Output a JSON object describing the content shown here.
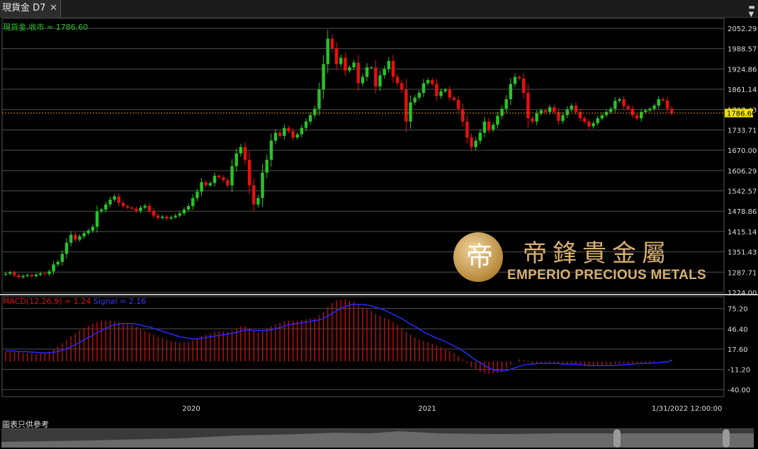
{
  "window": {
    "tab_title": "現貨金 D7",
    "close_glyph": "✕",
    "menu_glyph": "▬\n▼"
  },
  "legend": {
    "price": "現貨金.收市 = 1786.60",
    "macd": "MACD(12,26,9) = 1.24",
    "signal": "Signal = 2.16"
  },
  "footer": {
    "label": "圖表只供參考"
  },
  "logo": {
    "glyph": "帝",
    "chinese": "帝鋒貴金屬",
    "english": "EMPERIO PRECIOUS METALS"
  },
  "colors": {
    "up": "#27c427",
    "down": "#e81010",
    "macd_hist": "#e01010",
    "signal": "#2a2aff",
    "grid": "#505050",
    "last_price_line": "#d08a10"
  },
  "chart_data": [
    {
      "type": "candlestick",
      "title": "現貨金.收市",
      "x_labels": [
        "2020",
        "2021",
        "1/31/2022 12:00:00"
      ],
      "y_ticks": [
        1224.0,
        1287.71,
        1351.43,
        1415.14,
        1478.86,
        1542.57,
        1606.29,
        1670.0,
        1733.71,
        1797.43,
        1861.14,
        1924.86,
        1988.57,
        2052.29
      ],
      "ylim": [
        1224.0,
        2070.0
      ],
      "last_price": 1786.6,
      "last_price_label": "1786.60",
      "closes": [
        1283,
        1287,
        1278,
        1272,
        1276,
        1279,
        1275,
        1280,
        1284,
        1282,
        1290,
        1312,
        1320,
        1345,
        1380,
        1405,
        1390,
        1400,
        1410,
        1418,
        1430,
        1478,
        1484,
        1500,
        1515,
        1525,
        1505,
        1495,
        1490,
        1487,
        1480,
        1490,
        1496,
        1480,
        1465,
        1458,
        1462,
        1456,
        1460,
        1465,
        1472,
        1484,
        1495,
        1520,
        1540,
        1570,
        1560,
        1567,
        1590,
        1585,
        1576,
        1560,
        1620,
        1660,
        1680,
        1640,
        1560,
        1500,
        1520,
        1600,
        1640,
        1700,
        1725,
        1715,
        1740,
        1730,
        1710,
        1720,
        1740,
        1760,
        1780,
        1800,
        1860,
        1940,
        2020,
        1990,
        1940,
        1960,
        1920,
        1930,
        1945,
        1880,
        1900,
        1930,
        1930,
        1870,
        1905,
        1925,
        1950,
        1900,
        1880,
        1860,
        1760,
        1820,
        1835,
        1850,
        1880,
        1890,
        1878,
        1840,
        1855,
        1860,
        1835,
        1828,
        1800,
        1760,
        1710,
        1680,
        1700,
        1725,
        1760,
        1735,
        1750,
        1778,
        1800,
        1830,
        1878,
        1900,
        1895,
        1850,
        1770,
        1760,
        1785,
        1795,
        1790,
        1805,
        1790,
        1762,
        1780,
        1798,
        1810,
        1790,
        1770,
        1760,
        1745,
        1755,
        1770,
        1780,
        1790,
        1800,
        1825,
        1830,
        1808,
        1800,
        1780,
        1770,
        1790,
        1795,
        1800,
        1810,
        1830,
        1826,
        1800,
        1786.6
      ],
      "series": [
        {
          "name": "MACD(12,26,9)",
          "type": "bar",
          "values": [
            14,
            14,
            13,
            13,
            12,
            12,
            11,
            11,
            11,
            12,
            14,
            17,
            21,
            26,
            31,
            36,
            40,
            44,
            48,
            51,
            54,
            56,
            58,
            58,
            58,
            57,
            56,
            55,
            54,
            52,
            49,
            46,
            43,
            41,
            38,
            35,
            33,
            31,
            29,
            28,
            27,
            27,
            28,
            30,
            33,
            36,
            38,
            40,
            42,
            43,
            43,
            42,
            44,
            47,
            50,
            50,
            47,
            43,
            41,
            43,
            46,
            50,
            53,
            55,
            57,
            58,
            58,
            58,
            59,
            60,
            61,
            62,
            65,
            70,
            78,
            83,
            87,
            88,
            88,
            86,
            84,
            80,
            77,
            75,
            72,
            68,
            65,
            62,
            60,
            56,
            52,
            48,
            42,
            38,
            34,
            31,
            29,
            27,
            25,
            22,
            20,
            18,
            15,
            12,
            8,
            3,
            -3,
            -8,
            -12,
            -15,
            -17,
            -18,
            -17,
            -16,
            -14,
            -10,
            -5,
            0,
            3,
            2,
            -1,
            -3,
            -3,
            -3,
            -4,
            -3,
            -3,
            -4,
            -4,
            -4,
            -4,
            -5,
            -6,
            -7,
            -7,
            -7,
            -7,
            -7,
            -6,
            -5,
            -4,
            -3,
            -3,
            -3,
            -3,
            -3,
            -3,
            -3,
            -2,
            -1,
            0,
            0,
            0,
            1.24
          ]
        },
        {
          "name": "Signal",
          "type": "line",
          "values": [
            15,
            15,
            15,
            14,
            14,
            14,
            13,
            13,
            12,
            12,
            12,
            13,
            14,
            16,
            18,
            21,
            24,
            27,
            31,
            34,
            37,
            41,
            44,
            47,
            50,
            52,
            53,
            54,
            54,
            54,
            53,
            52,
            50,
            49,
            47,
            45,
            43,
            41,
            39,
            37,
            35,
            34,
            33,
            32,
            32,
            33,
            34,
            35,
            36,
            37,
            38,
            39,
            40,
            41,
            43,
            44,
            45,
            44,
            44,
            44,
            44,
            45,
            47,
            48,
            50,
            52,
            53,
            54,
            55,
            56,
            57,
            58,
            59,
            61,
            65,
            68,
            72,
            75,
            78,
            80,
            81,
            81,
            81,
            80,
            79,
            77,
            75,
            73,
            70,
            67,
            64,
            61,
            57,
            53,
            50,
            46,
            42,
            39,
            36,
            33,
            31,
            28,
            25,
            22,
            19,
            15,
            11,
            6,
            2,
            -2,
            -6,
            -9,
            -12,
            -13,
            -14,
            -13,
            -11,
            -9,
            -7,
            -5,
            -4,
            -4,
            -3,
            -3,
            -3,
            -3,
            -3,
            -3,
            -4,
            -4,
            -4,
            -4,
            -5,
            -5,
            -6,
            -6,
            -6,
            -6,
            -6,
            -6,
            -6,
            -5,
            -5,
            -4,
            -4,
            -3,
            -3,
            -3,
            -3,
            -2,
            -2,
            -1,
            -1,
            2.16
          ]
        }
      ],
      "macd_y_ticks": [
        -40.0,
        -11.2,
        17.6,
        46.4,
        75.2
      ],
      "macd_ylim": [
        -50.0,
        92.0
      ]
    }
  ]
}
